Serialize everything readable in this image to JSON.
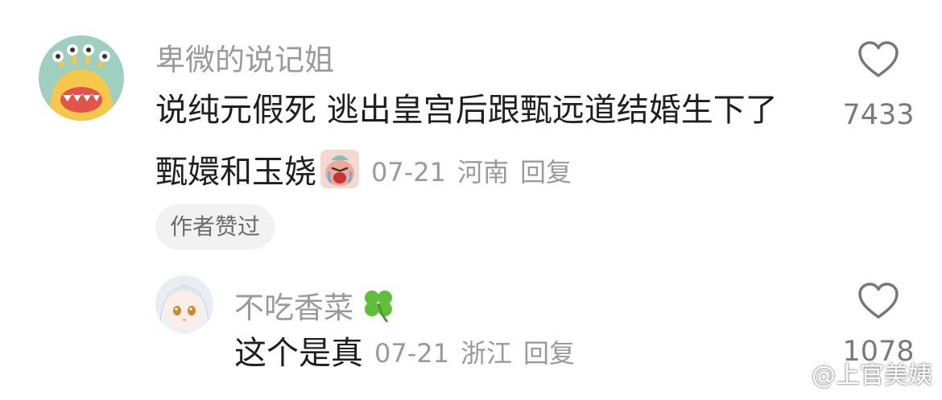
{
  "comment": {
    "username": "卑微的说记姐",
    "text_line1": "说纯元假死 逃出皇宫后跟甄远道结婚生下了",
    "text_line2": "甄嬛和玉娆",
    "emoji": "crying-face-sticker",
    "date": "07-21",
    "location": "河南",
    "reply_label": "回复",
    "likes": "7433",
    "author_badge": "作者赞过"
  },
  "reply": {
    "username": "不吃香菜",
    "username_emoji": "four-leaf-clover",
    "text": "这个是真",
    "date": "07-21",
    "location": "浙江",
    "reply_label": "回复",
    "likes": "1078"
  },
  "watermark": {
    "text": "@上官美姨",
    "icon": "weibo-logo"
  },
  "colors": {
    "username": "#9a9a9a",
    "body_text": "#1f1f1f",
    "meta": "#9a9a9a",
    "badge_bg": "#f2f2f2"
  }
}
